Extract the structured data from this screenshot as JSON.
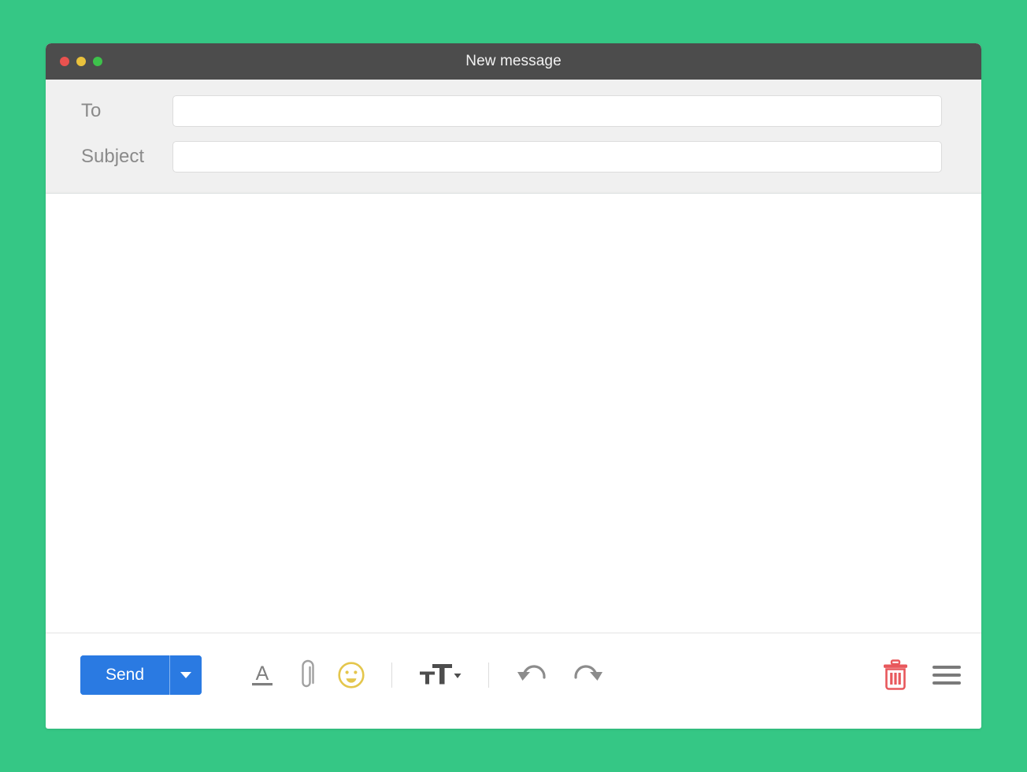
{
  "page": {
    "background_color": "#35c785"
  },
  "window": {
    "title": "New message",
    "titlebar_color": "#4c4c4c",
    "traffic_lights": [
      {
        "name": "close",
        "color": "#e9524f"
      },
      {
        "name": "minimize",
        "color": "#e9c13c"
      },
      {
        "name": "maximize",
        "color": "#3dc24b"
      }
    ]
  },
  "header": {
    "fields": [
      {
        "label": "To",
        "value": "",
        "placeholder": ""
      },
      {
        "label": "Subject",
        "value": "",
        "placeholder": ""
      }
    ]
  },
  "body": {
    "content": "",
    "placeholder": ""
  },
  "toolbar": {
    "send_label": "Send",
    "send_color": "#2a7ae2",
    "send_dropdown_icon": "chevron-down-icon",
    "tools": [
      {
        "name": "text-color-icon",
        "label": "A",
        "color": "#7a7a7a"
      },
      {
        "name": "attachment-icon",
        "label": "",
        "color": "#9a9a9a"
      },
      {
        "name": "emoji-icon",
        "label": "",
        "color": "#e3c44a"
      },
      {
        "name": "separator",
        "label": "",
        "color": "#dcdcdc"
      },
      {
        "name": "font-size-icon",
        "label": "tT",
        "color": "#4d4d4d"
      },
      {
        "name": "separator",
        "label": "",
        "color": "#dcdcdc"
      },
      {
        "name": "undo-icon",
        "label": "",
        "color": "#8c8c8c"
      },
      {
        "name": "redo-icon",
        "label": "",
        "color": "#8c8c8c"
      }
    ],
    "right_tools": [
      {
        "name": "trash-icon",
        "label": "",
        "color": "#e8585c"
      },
      {
        "name": "menu-icon",
        "label": "",
        "color": "#7a7a7a"
      }
    ]
  }
}
